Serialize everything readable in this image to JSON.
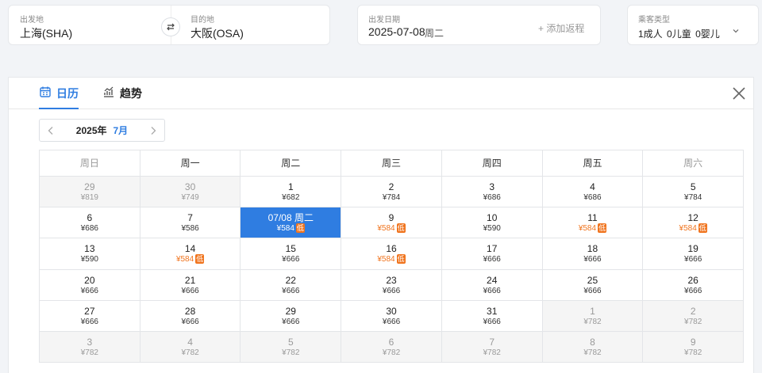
{
  "route": {
    "from_label": "出发地",
    "from_value": "上海(SHA)",
    "to_label": "目的地",
    "to_value": "大阪(OSA)"
  },
  "date": {
    "label": "出发日期",
    "value": "2025-07-08",
    "weekday": "周二",
    "add_return": "+ 添加返程"
  },
  "passengers": {
    "label": "乘客类型",
    "adults": "1成人",
    "children": "0儿童",
    "infants": "0婴儿"
  },
  "tabs": {
    "calendar": "日历",
    "trend": "趋势"
  },
  "month_nav": {
    "year": "2025年",
    "month": "7月"
  },
  "weekdays": [
    "周日",
    "周一",
    "周二",
    "周三",
    "周四",
    "周五",
    "周六"
  ],
  "low_badge": "低",
  "colors": {
    "accent": "#2f7de1",
    "low_price": "#f0741e"
  },
  "calendar": [
    [
      {
        "day": "29",
        "price": "¥819",
        "state": "other"
      },
      {
        "day": "30",
        "price": "¥749",
        "state": "other"
      },
      {
        "day": "1",
        "price": "¥682"
      },
      {
        "day": "2",
        "price": "¥784"
      },
      {
        "day": "3",
        "price": "¥686"
      },
      {
        "day": "4",
        "price": "¥686"
      },
      {
        "day": "5",
        "price": "¥784"
      }
    ],
    [
      {
        "day": "6",
        "price": "¥686"
      },
      {
        "day": "7",
        "price": "¥586"
      },
      {
        "day": "07/08 周二",
        "price": "¥584",
        "state": "selected",
        "low": true
      },
      {
        "day": "9",
        "price": "¥584",
        "low": true
      },
      {
        "day": "10",
        "price": "¥590"
      },
      {
        "day": "11",
        "price": "¥584",
        "low": true
      },
      {
        "day": "12",
        "price": "¥584",
        "low": true
      }
    ],
    [
      {
        "day": "13",
        "price": "¥590"
      },
      {
        "day": "14",
        "price": "¥584",
        "low": true
      },
      {
        "day": "15",
        "price": "¥666"
      },
      {
        "day": "16",
        "price": "¥584",
        "low": true
      },
      {
        "day": "17",
        "price": "¥666"
      },
      {
        "day": "18",
        "price": "¥666"
      },
      {
        "day": "19",
        "price": "¥666"
      }
    ],
    [
      {
        "day": "20",
        "price": "¥666"
      },
      {
        "day": "21",
        "price": "¥666"
      },
      {
        "day": "22",
        "price": "¥666"
      },
      {
        "day": "23",
        "price": "¥666"
      },
      {
        "day": "24",
        "price": "¥666"
      },
      {
        "day": "25",
        "price": "¥666"
      },
      {
        "day": "26",
        "price": "¥666"
      }
    ],
    [
      {
        "day": "27",
        "price": "¥666"
      },
      {
        "day": "28",
        "price": "¥666"
      },
      {
        "day": "29",
        "price": "¥666"
      },
      {
        "day": "30",
        "price": "¥666"
      },
      {
        "day": "31",
        "price": "¥666"
      },
      {
        "day": "1",
        "price": "¥782",
        "state": "other"
      },
      {
        "day": "2",
        "price": "¥782",
        "state": "other"
      }
    ],
    [
      {
        "day": "3",
        "price": "¥782",
        "state": "other"
      },
      {
        "day": "4",
        "price": "¥782",
        "state": "other"
      },
      {
        "day": "5",
        "price": "¥782",
        "state": "other"
      },
      {
        "day": "6",
        "price": "¥782",
        "state": "other"
      },
      {
        "day": "7",
        "price": "¥782",
        "state": "other"
      },
      {
        "day": "8",
        "price": "¥782",
        "state": "other"
      },
      {
        "day": "9",
        "price": "¥782",
        "state": "other"
      }
    ]
  ]
}
